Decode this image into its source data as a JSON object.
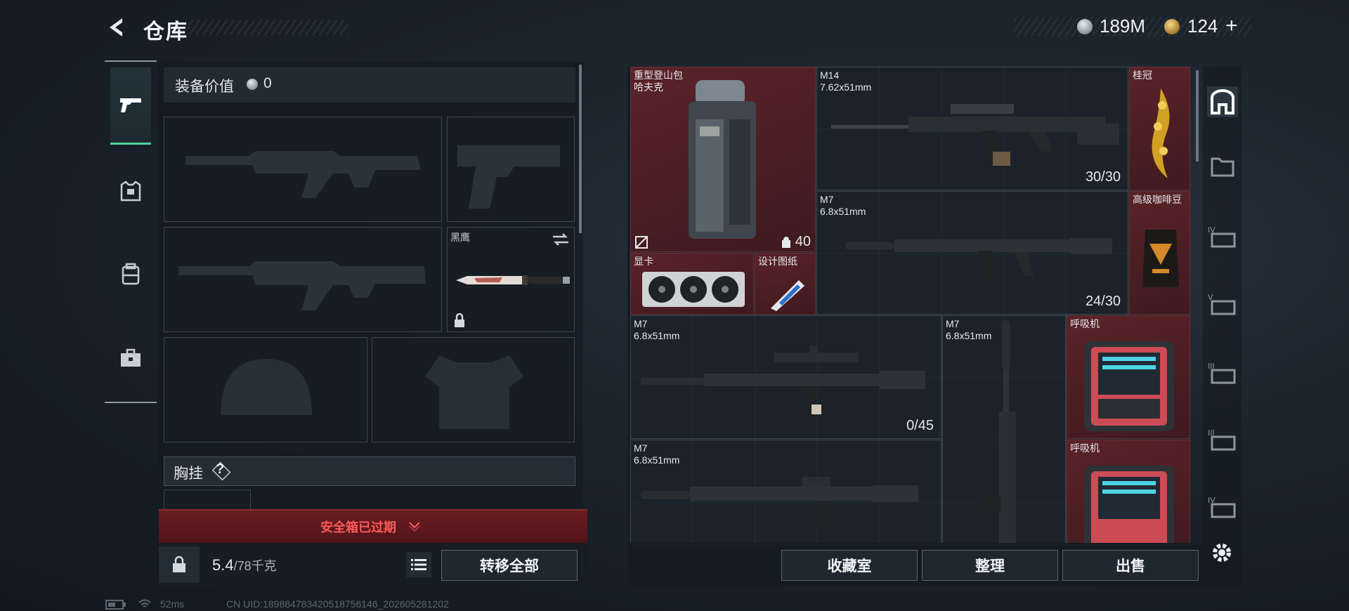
{
  "header": {
    "title": "仓库",
    "currency_1": "189M",
    "currency_2": "124",
    "add_label": "+"
  },
  "left_panel": {
    "equipment_value_label": "装备价值",
    "equipment_value": "0",
    "melee_slot_label": "黑鹰",
    "chest_rig_label": "胸挂",
    "help_label": "?",
    "safebox_status": "安全箱已过期",
    "weight_current": "5.4",
    "weight_max": "/78千克",
    "transfer_all_label": "转移全部"
  },
  "stash": {
    "items": [
      {
        "name": "重型登山包",
        "sub": "哈夫克",
        "count": "40"
      },
      {
        "name": "M14",
        "sub": "7.62x51mm",
        "count": "30/30"
      },
      {
        "name": "桂冠",
        "sub": "",
        "count": ""
      },
      {
        "name": "M7",
        "sub": "6.8x51mm",
        "count": "24/30"
      },
      {
        "name": "高级咖啡豆",
        "sub": "",
        "count": ""
      },
      {
        "name": "显卡",
        "sub": "",
        "count": ""
      },
      {
        "name": "设计图纸",
        "sub": "",
        "count": ""
      },
      {
        "name": "M7",
        "sub": "6.8x51mm",
        "count": "0/45"
      },
      {
        "name": "M7",
        "sub": "6.8x51mm",
        "count": ""
      },
      {
        "name": "呼吸机",
        "sub": "",
        "count": ""
      },
      {
        "name": "M7",
        "sub": "6.8x51mm",
        "count": ""
      },
      {
        "name": "呼吸机",
        "sub": "",
        "count": ""
      }
    ]
  },
  "actions": {
    "collection_label": "收藏室",
    "organize_label": "整理",
    "sell_label": "出售"
  },
  "sidebar": {
    "tiers": [
      "IV",
      "V",
      "III",
      "III",
      "IV"
    ]
  },
  "status_bar": {
    "ping": "52ms",
    "uid": "CN UID:18988478342051875614​6_202605281202"
  },
  "colors": {
    "accent_green": "#4fd39c",
    "danger_red": "#ff5a5a",
    "rare_red_bg": "#5a2329"
  }
}
